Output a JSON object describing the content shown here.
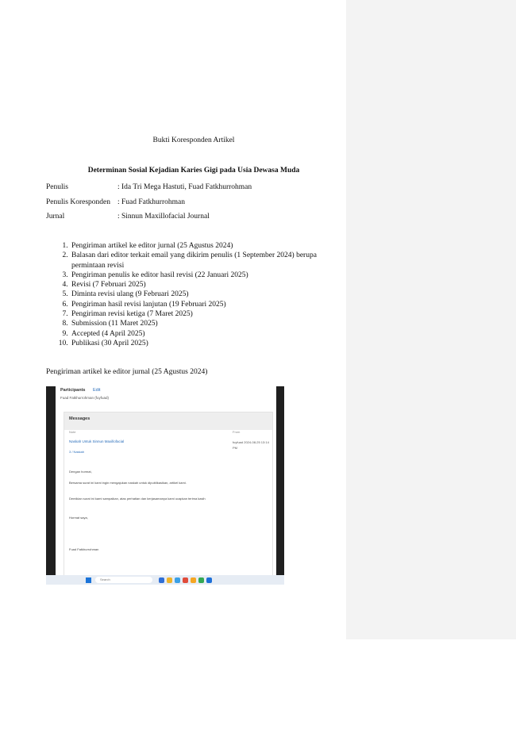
{
  "document": {
    "heading": "Bukti Koresponden Artikel",
    "article_title": "Determinan Sosial Kejadian Karies Gigi pada Usia Dewasa Muda",
    "meta": [
      {
        "label": "Penulis",
        "value": ": Ida Tri Mega Hastuti, Fuad Fatkhurrohman"
      },
      {
        "label": "Penulis Koresponden",
        "value": ": Fuad Fatkhurrohman"
      },
      {
        "label": "Jurnal",
        "value": ": Sinnun Maxillofacial Journal"
      }
    ],
    "steps": [
      "Pengiriman artikel ke editor jurnal (25 Agustus 2024)",
      "Balasan dari editor terkait email yang dikirim penulis (1 September 2024) berupa permintaan revisi",
      "Pengiriman penulis ke editor hasil revisi (22 Januari 2025)",
      "Revisi (7 Februari 2025)",
      "Diminta revisi ulang (9 Februari 2025)",
      "Pengiriman hasil revisi lanjutan (19 Februari 2025)",
      "Pengiriman revisi ketiga (7 Maret 2025)",
      "Submission (11 Maret 2025)",
      "Accepted (4 April 2025)",
      "Publikasi (30 April 2025)"
    ],
    "section_heading": "Pengiriman artikel ke editor jurnal (25 Agustus 2024)"
  },
  "screenshot": {
    "participants_label": "Participants",
    "edit_label": "Edit",
    "participant_name": "Fuad Fatkhurrohman (fuyfuad)",
    "messages_title": "Messages",
    "col_note": "Note",
    "col_from": "From",
    "subject": "Naskah Untuk Sinnun Maxillofacial",
    "attachment": "3 / Naskah",
    "from": "fuyfuad 2024-08-25 13:14 PM",
    "greeting": "Dengan hormat,",
    "para1": "Bersama surat ini kami ingin mengajukan naskah untuk dipublikasikan, artikel kami.",
    "para2": "Demikian surat ini kami sampaikan, atas perhatian dan kerjasamanya kami ucapkan terima kasih",
    "closing": "Hormat saya,",
    "signature": "Fuad Fatkhurrohman",
    "search_placeholder": "Search"
  },
  "colors": {
    "comment_pane": "#f3f3f3",
    "link": "#2a6ebb"
  }
}
